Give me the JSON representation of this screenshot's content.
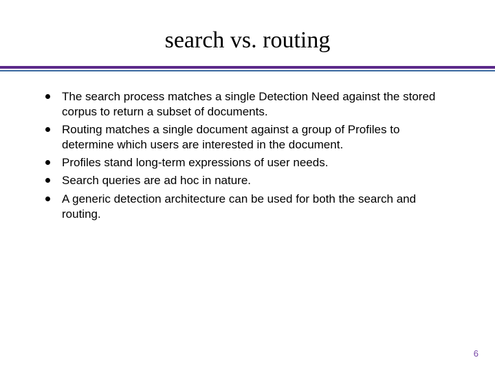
{
  "title": "search vs. routing",
  "bullets": [
    "The search process matches a single Detection Need against the stored corpus to return a subset of documents.",
    "Routing matches a single document against a group of Profiles to determine which users are interested in the document.",
    "Profiles stand long-term expressions of user needs.",
    "Search queries are ad hoc in nature.",
    "A generic detection architecture can be used for both the search and routing."
  ],
  "page_number": "6",
  "colors": {
    "rule_primary": "#5c2a8a",
    "rule_secondary": "#3a6aa0",
    "pagenum": "#7a4aa8"
  }
}
